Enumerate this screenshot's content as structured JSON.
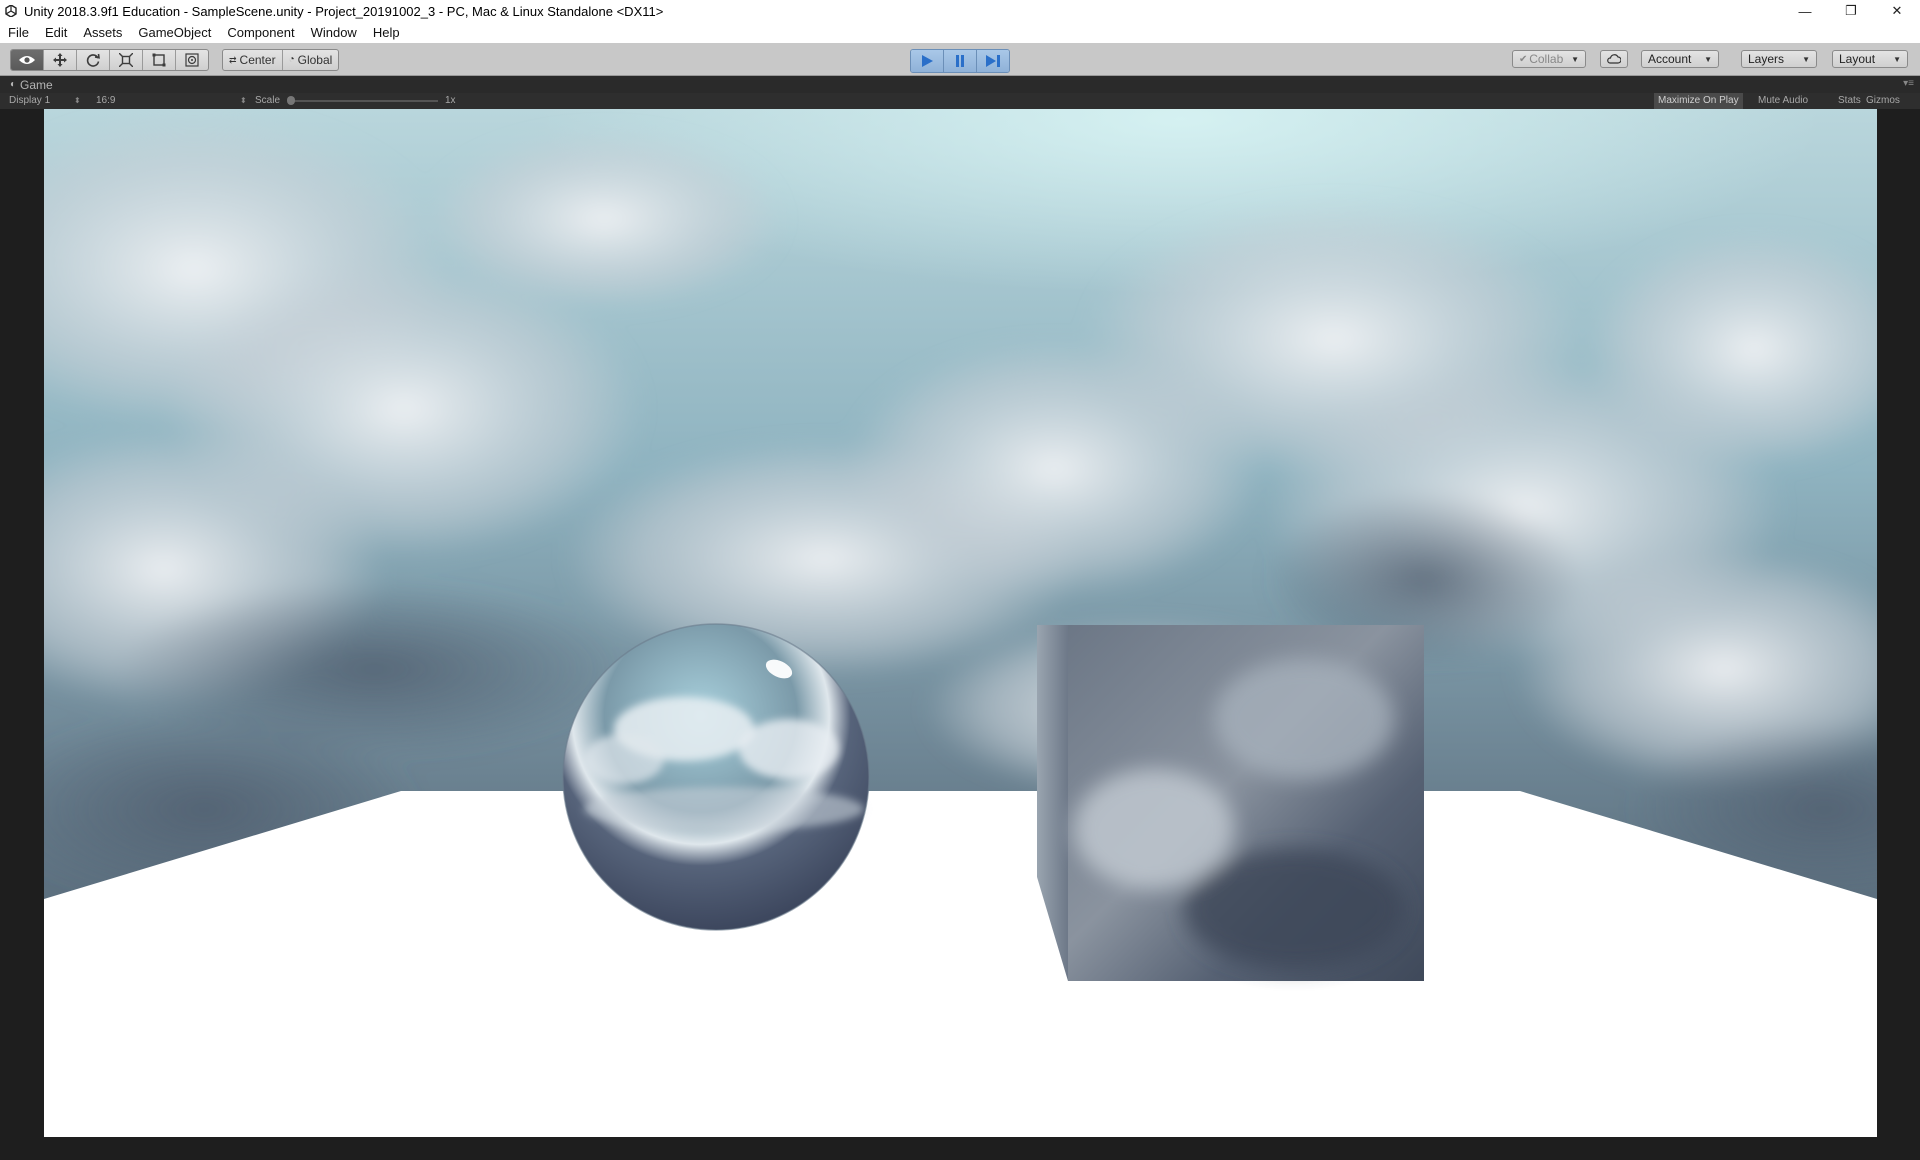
{
  "window": {
    "title": "Unity 2018.3.9f1 Education - SampleScene.unity - Project_20191002_3 - PC, Mac & Linux Standalone <DX11>",
    "controls": {
      "minimize": "—",
      "restore": "❐",
      "close": "✕"
    }
  },
  "menu": [
    "File",
    "Edit",
    "Assets",
    "GameObject",
    "Component",
    "Window",
    "Help"
  ],
  "toolbar": {
    "transform_tools": [
      {
        "icon": "eye-icon",
        "glyph": "👁",
        "active": true
      },
      {
        "icon": "move-icon",
        "glyph": "✥"
      },
      {
        "icon": "rotate-icon",
        "glyph": "⟳"
      },
      {
        "icon": "scale-icon",
        "glyph": "⤢"
      },
      {
        "icon": "rect-icon",
        "glyph": "▣"
      },
      {
        "icon": "transform-icon",
        "glyph": "◎"
      }
    ],
    "pivot_mode": "Center",
    "pivot_rotation": "Global",
    "collab": "Collab",
    "account": "Account",
    "layers": "Layers",
    "layout": "Layout",
    "accent_play": "#2a6fc9"
  },
  "game_panel": {
    "tab_label": "Game",
    "display": "Display 1",
    "aspect": "16:9",
    "scale_label": "Scale",
    "scale_value": "1x",
    "maximize_on_play": "Maximize On Play",
    "mute_audio": "Mute Audio",
    "stats": "Stats",
    "gizmos": "Gizmos"
  }
}
